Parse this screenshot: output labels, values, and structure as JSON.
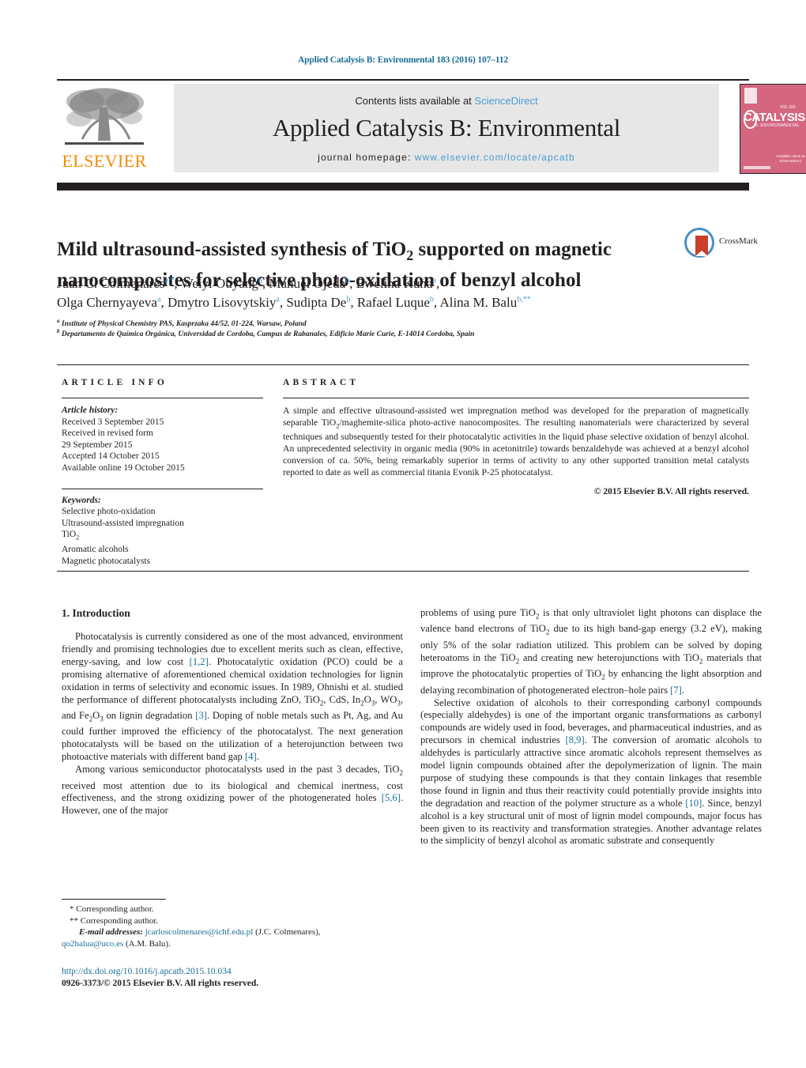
{
  "running_head": "Applied Catalysis B: Environmental 183 (2016) 107–112",
  "masthead": {
    "contents_prefix": "Contents lists available at ",
    "sciencedirect_link": "ScienceDirect",
    "journal_title": "Applied Catalysis B: Environmental",
    "homepage_prefix": "journal homepage: ",
    "homepage_link": "www.elsevier.com/locate/apcatb",
    "publisher_wordmark": "ELSEVIER",
    "cover": {
      "word": "CATALYSIS",
      "subtitle": "B: ENVIRONMENTAL",
      "tag": "VOL 183",
      "foot": "Available online at ScienceDirect"
    }
  },
  "article": {
    "title_line1": "Mild ultrasound-assisted synthesis of TiO",
    "title_sub1": "2",
    "title_line1b": " supported on magnetic",
    "title_line2": "nanocomposites for selective photo-oxidation of benzyl alcohol",
    "crossmark_label": "CrossMark",
    "authors_html": "Juan C. Colmenares<sup class=\"aff-mark\">a,*</sup>, Weiyi Ouyang<sup class=\"aff-mark\">b</sup>, Manuel Ojeda<sup class=\"aff-mark\">b</sup>, Ewelina Kuna<sup class=\"aff-mark\">a</sup>,<br>Olga Chernyayeva<sup class=\"aff-mark\">a</sup>, Dmytro Lisovytskiy<sup class=\"aff-mark\">a</sup>, Sudipta De<sup class=\"aff-mark\">b</sup>, Rafael Luque<sup class=\"aff-mark\">b</sup>, Alina M. Balu<sup class=\"aff-mark\">b,**</sup>",
    "affiliation_a": "Institute of Physical Chemistry PAS, Kasprzaka 44/52, 01-224, Warsaw, Poland",
    "affiliation_b": "Departamento de Química Orgánica, Universidad de Cordoba, Campus de Rabanales, Edificio Marie Curie, E-14014 Cordoba, Spain"
  },
  "article_info": {
    "heading": "ARTICLE INFO",
    "history_label": "Article history:",
    "history": [
      "Received 3 September 2015",
      "Received in revised form",
      "29 September 2015",
      "Accepted 14 October 2015",
      "Available online 19 October 2015"
    ],
    "keywords_label": "Keywords:",
    "keywords": [
      "Selective photo-oxidation",
      "Ultrasound-assisted impregnation",
      "TiO2",
      "Aromatic alcohols",
      "Magnetic photocatalysts"
    ]
  },
  "abstract": {
    "heading": "ABSTRACT",
    "text_html": "A simple and effective ultrasound-assisted wet impregnation method was developed for the preparation of magnetically separable TiO<sub>2</sub>/maghemite-silica photo-active nanocomposites. The resulting nanomaterials were characterized by several techniques and subsequently tested for their photocatalytic activities in the liquid phase selective oxidation of benzyl alcohol. An unprecedented selectivity in organic media (90% in acetonitrile) towards benzaldehyde was achieved at a benzyl alcohol conversion of ca. 50%, being remarkably superior in terms of activity to any other supported transition metal catalysts reported to date as well as commercial titania Evonik P-25 photocatalyst.",
    "copyright": "© 2015 Elsevier B.V. All rights reserved."
  },
  "body": {
    "section_title": "1.  Introduction",
    "left_p1_html": "Photocatalysis is currently considered as one of the most advanced, environment friendly and promising technologies due to excellent merits such as clean, effective, energy-saving, and low cost <span class=\"cit\">[1,2]</span>. Photocatalytic oxidation (PCO) could be a promising alternative of aforementioned chemical oxidation technologies for lignin oxidation in terms of selectivity and economic issues. In 1989, Ohnishi et al. studied the performance of different photocatalysts including ZnO, TiO<sub>2</sub>, CdS, In<sub>2</sub>O<sub>3</sub>, WO<sub>3</sub>, and Fe<sub>2</sub>O<sub>3</sub> on lignin degradation <span class=\"cit\">[3]</span>. Doping of noble metals such as Pt, Ag, and Au could further improved the efficiency of the photocatalyst. The next generation photocatalysts will be based on the utilization of a heterojunction between two photoactive materials with different band gap <span class=\"cit\">[4]</span>.",
    "left_p2_html": "Among various semiconductor photocatalysts used in the past 3 decades, TiO<sub>2</sub> received most attention due to its biological and chemical inertness, cost effectiveness, and the strong oxidizing power of the photogenerated holes <span class=\"cit\">[5,6]</span>. However, one of the major",
    "right_p1_html": "problems of using pure TiO<sub>2</sub> is that only ultraviolet light photons can displace the valence band electrons of TiO<sub>2</sub> due to its high band-gap energy (3.2 eV), making only 5% of the solar radiation utilized. This problem can be solved by doping heteroatoms in the TiO<sub>2</sub> and creating new heterojunctions with TiO<sub>2</sub> materials that improve the photocatalytic properties of TiO<sub>2</sub> by enhancing the light absorption and delaying recombination of photogenerated electron–hole pairs <span class=\"cit\">[7]</span>.",
    "right_p2_html": "Selective oxidation of alcohols to their corresponding carbonyl compounds (especially aldehydes) is one of the important organic transformations as carbonyl compounds are widely used in food, beverages, and pharmaceutical industries, and as precursors in chemical industries <span class=\"cit\">[8,9]</span>. The conversion of aromatic alcohols to aldehydes is particularly attractive since aromatic alcohols represent themselves as model lignin compounds obtained after the depolymerization of lignin. The main purpose of studying these compounds is that they contain linkages that resemble those found in lignin and thus their reactivity could potentially provide insights into the degradation and reaction of the polymer structure as a whole <span class=\"cit\">[10]</span>. Since, benzyl alcohol is a key structural unit of most of lignin model compounds, major focus has been given to its reactivity and transformation strategies. Another advantage relates to the simplicity of benzyl alcohol as aromatic substrate and consequently"
  },
  "footnotes": {
    "corresponding_1": "*  Corresponding author.",
    "corresponding_2": "**  Corresponding author.",
    "email_label": "E-mail addresses:",
    "email_1": "jcarloscolmenares@ichf.edu.pl",
    "email_1_owner": " (J.C. Colmenares),",
    "email_2": "qo2baluа@uco.es",
    "email_2_owner": " (A.M. Balu)."
  },
  "doi": {
    "url": "http://dx.doi.org/10.1016/j.apcatb.2015.10.034",
    "issn_line": "0926-3373/© 2015 Elsevier B.V. All rights reserved."
  },
  "colors": {
    "link_blue": "#1a6e96",
    "sciencedirect_blue": "#4a9bd1",
    "elsevier_orange": "#f38b00",
    "cover_pink": "#d4667f",
    "rule_dark": "#231f20"
  }
}
